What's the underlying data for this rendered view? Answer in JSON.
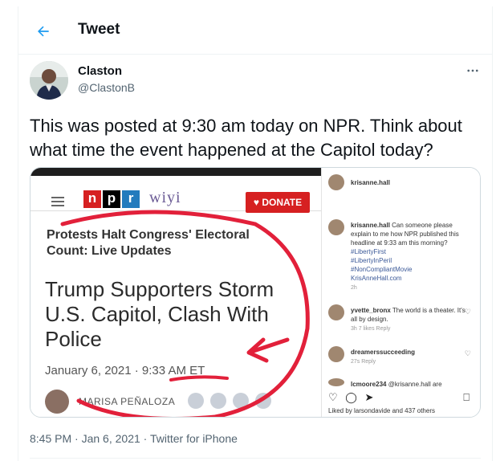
{
  "header": {
    "title": "Tweet",
    "back_icon": "arrow-left-icon"
  },
  "author": {
    "name": "Claston",
    "handle": "@ClastonB"
  },
  "tweet": {
    "text": "This was posted at 9:30 am today on NPR. Think about what time the event happened at the Capitol today?"
  },
  "meta": {
    "time": "8:45 PM",
    "sep1": "·",
    "date": "Jan 6, 2021",
    "sep2": "·",
    "source": "Twitter for iPhone"
  },
  "media": {
    "npr": {
      "logo_letters": [
        "n",
        "p",
        "r"
      ],
      "logo_colors": [
        "#d62021",
        "#000000",
        "#237bbd"
      ],
      "station": "wiyi",
      "donate": "DONATE",
      "subhead": "Protests Halt Congress' Electoral Count: Live Updates",
      "headline": "Trump Supporters Storm U.S. Capitol, Clash With Police",
      "date": "January 6, 2021",
      "date_sep": "·",
      "time": "9:33 AM ET",
      "byline": "MARISA PEÑALOZA"
    },
    "instagram": {
      "top_user": "krisanne.hall",
      "comments": [
        {
          "user": "krisanne.hall",
          "text": "Can someone please explain to me how NPR published this headline at 9:33 am this morning?",
          "tags": [
            "#LibertyFirst",
            "#LibertyInPeril",
            "#NonCompliantMovie",
            "KrisAnneHall.com"
          ],
          "sub": "2h"
        },
        {
          "user": "yvette_bronx",
          "text": "The world is a theater. It's all by design.",
          "sub": "3h  7 likes  Reply"
        },
        {
          "user": "dreamerssucceeding",
          "text": "",
          "sub": "27s  Reply"
        },
        {
          "user": "lcmoore234",
          "text": "@krisanne.hall are",
          "sub": ""
        }
      ],
      "likes": "Liked by larsondavide and 437 others"
    }
  },
  "colors": {
    "accent": "#1d9bf0",
    "text": "#0f1419",
    "muted": "#536471",
    "npr_red": "#d62021"
  }
}
